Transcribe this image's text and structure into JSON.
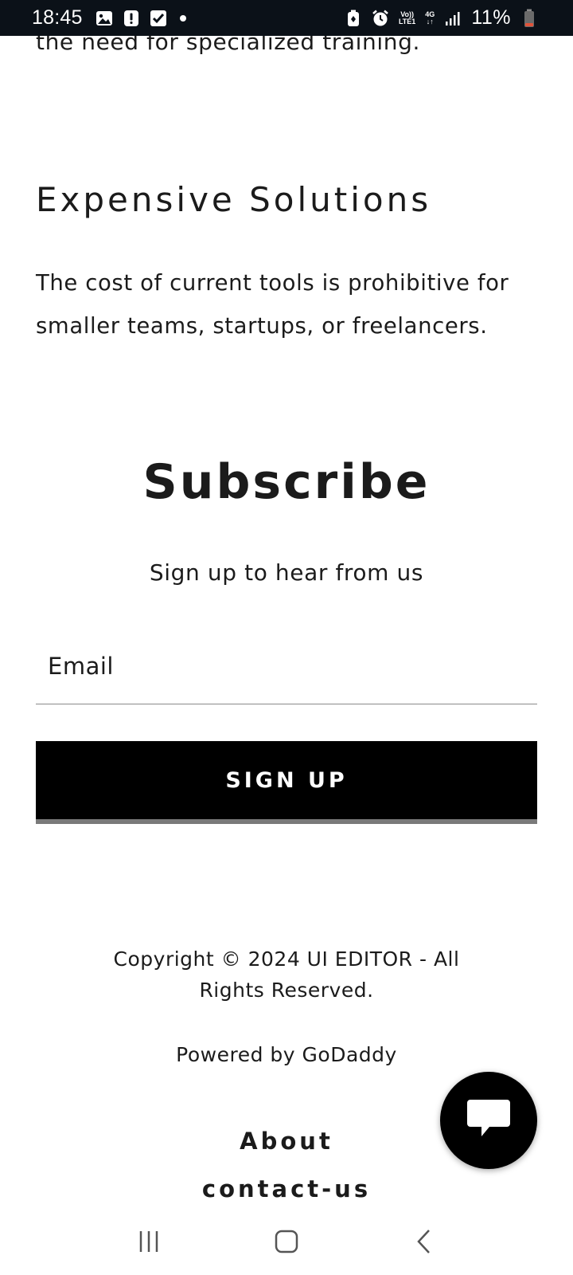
{
  "status_bar": {
    "time": "18:45",
    "battery_percent": "11%",
    "network_label": "4G",
    "volte_label_top": "Vo))",
    "volte_label_bottom": "LTE1",
    "icons": [
      "gallery-icon",
      "alert-icon",
      "checkbox-icon",
      "notification-dot-icon",
      "battery-saver-icon",
      "alarm-icon",
      "volte-icon",
      "network-4g-icon",
      "signal-icon",
      "battery-icon"
    ]
  },
  "content": {
    "clipped_text": "the need for specialized training.",
    "section_heading": "Expensive Solutions",
    "section_body": "The cost of current tools is prohibitive for smaller teams, startups, or freelancers."
  },
  "subscribe": {
    "title": "Subscribe",
    "subtitle": "Sign up to hear from us",
    "email_placeholder": "Email",
    "email_value": "",
    "button_label": "SIGN UP"
  },
  "footer": {
    "copyright": "Copyright © 2024 UI EDITOR - All Rights Reserved.",
    "powered_prefix": "Powered by ",
    "powered_link": "GoDaddy",
    "links": [
      "About",
      "contact-us"
    ]
  },
  "chat": {
    "icon": "chat-bubble-icon"
  },
  "nav_bar": {
    "icons": [
      "recent-apps-icon",
      "home-icon",
      "back-icon"
    ]
  },
  "colors": {
    "status_bar_bg": "#0b1118",
    "text": "#1b1b1b",
    "button_bg": "#000000",
    "button_border": "#7a7a7a",
    "battery_low": "#e0533a"
  }
}
